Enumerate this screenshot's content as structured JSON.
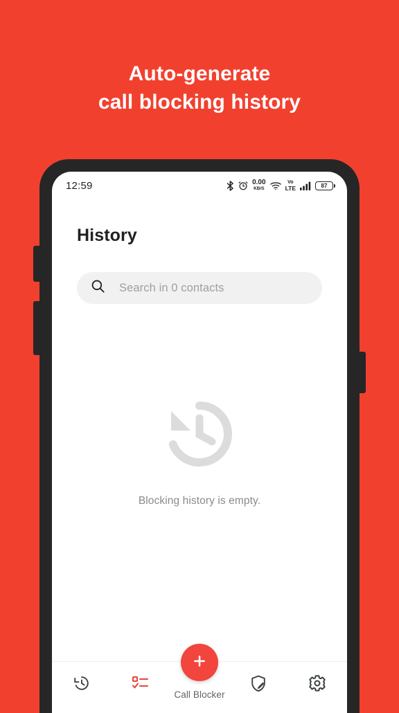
{
  "promo": {
    "line1": "Auto-generate",
    "line2": "call blocking history",
    "text_color": "#FFFFFF",
    "background_color": "#F2402F"
  },
  "phone": {
    "frame_color": "#262626",
    "screen_color": "#FFFFFF",
    "buttons": [
      {
        "name": "volume-up"
      },
      {
        "name": "volume-down"
      },
      {
        "name": "power"
      }
    ]
  },
  "status_bar": {
    "time": "12:59",
    "icons": [
      "bluetooth-icon",
      "alarm-icon",
      "network-speed-indicator",
      "wifi-icon",
      "volte-icon",
      "cellular-signal-icon",
      "battery-icon"
    ],
    "network_speed_value": "0.00",
    "network_speed_unit": "KB/S",
    "volte_top": "Vo",
    "volte_bottom": "LTE",
    "battery_level": "87"
  },
  "header": {
    "title": "History"
  },
  "search": {
    "placeholder": "Search in 0 contacts",
    "value": "",
    "icon": "search-icon",
    "background_color": "#F1F1F1"
  },
  "empty_state": {
    "icon": "history-clock-icon",
    "icon_color": "#DCDCDC",
    "message": "Blocking history is empty."
  },
  "fab": {
    "icon": "plus-icon",
    "label": "Call Blocker",
    "color": "#F1453D"
  },
  "bottom_nav": {
    "items": [
      {
        "name": "history",
        "icon": "history-clock-icon",
        "active": false
      },
      {
        "name": "block-list",
        "icon": "checklist-icon",
        "active": true
      },
      {
        "name": "protection",
        "icon": "shield-edit-icon",
        "active": false
      },
      {
        "name": "settings",
        "icon": "gear-icon",
        "active": false
      }
    ],
    "active_color": "#E5453A",
    "inactive_color": "#3C4043"
  }
}
